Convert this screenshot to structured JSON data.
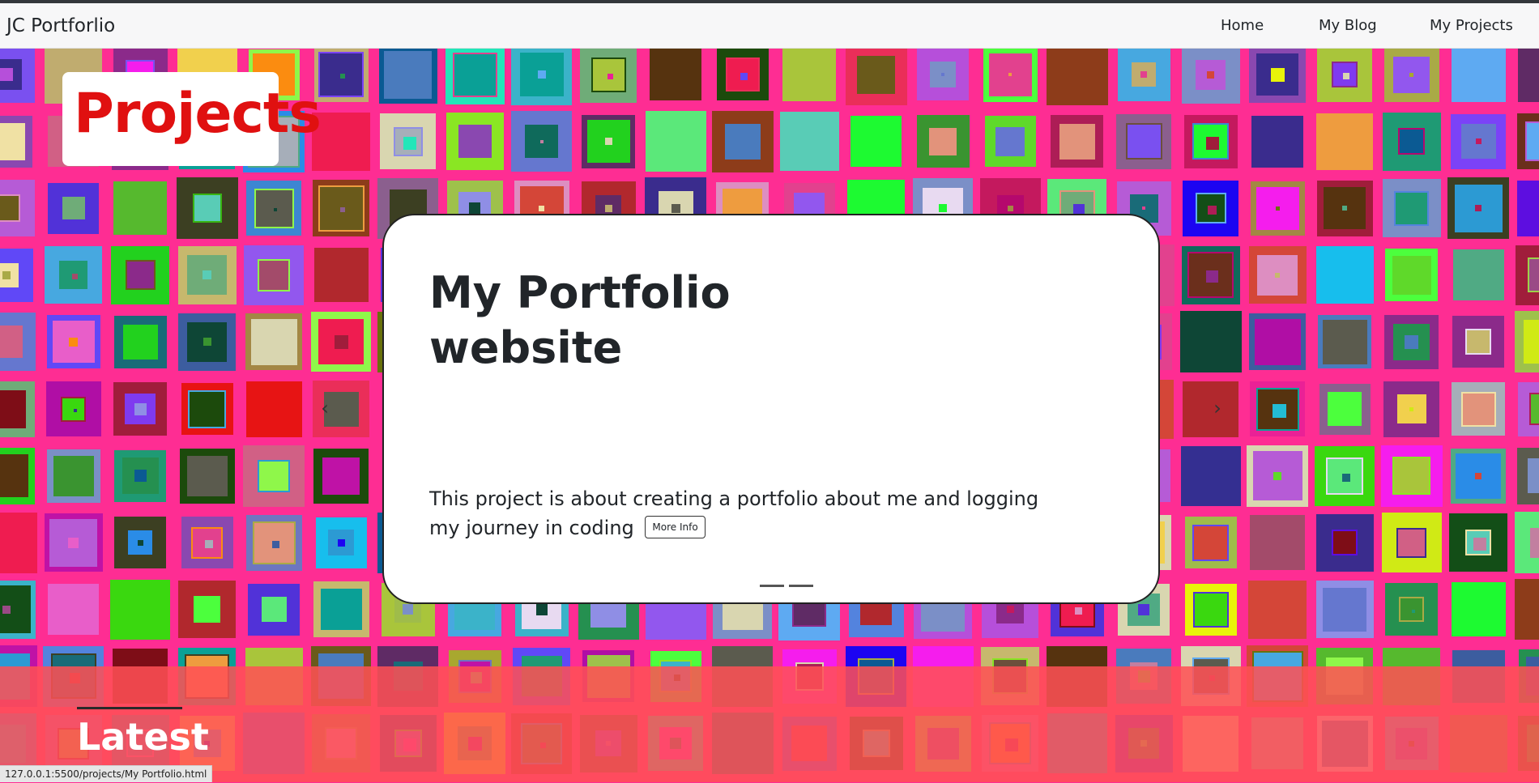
{
  "navbar": {
    "brand": "JC Portforlio",
    "links": [
      "Home",
      "My Blog",
      "My Projects"
    ]
  },
  "hero": {
    "badge_title": "Projects"
  },
  "card": {
    "title": "My Portfolio website",
    "description": "This project is about creating a portfolio about me and logging my journey in coding",
    "more_info_label": "More Info",
    "slide_count": 2,
    "active_slide": 1
  },
  "carousel": {
    "prev_icon": "chevron-left-icon",
    "next_icon": "chevron-right-icon"
  },
  "section": {
    "latest_title": "Latest"
  },
  "statusbar": {
    "url": "127.0.0.1:5500/projects/My Portfolio.html"
  },
  "colors": {
    "background": "#fe2d93",
    "title_red": "#e01010",
    "band": "#ff5055",
    "nav_bg": "#f7f7f8"
  }
}
